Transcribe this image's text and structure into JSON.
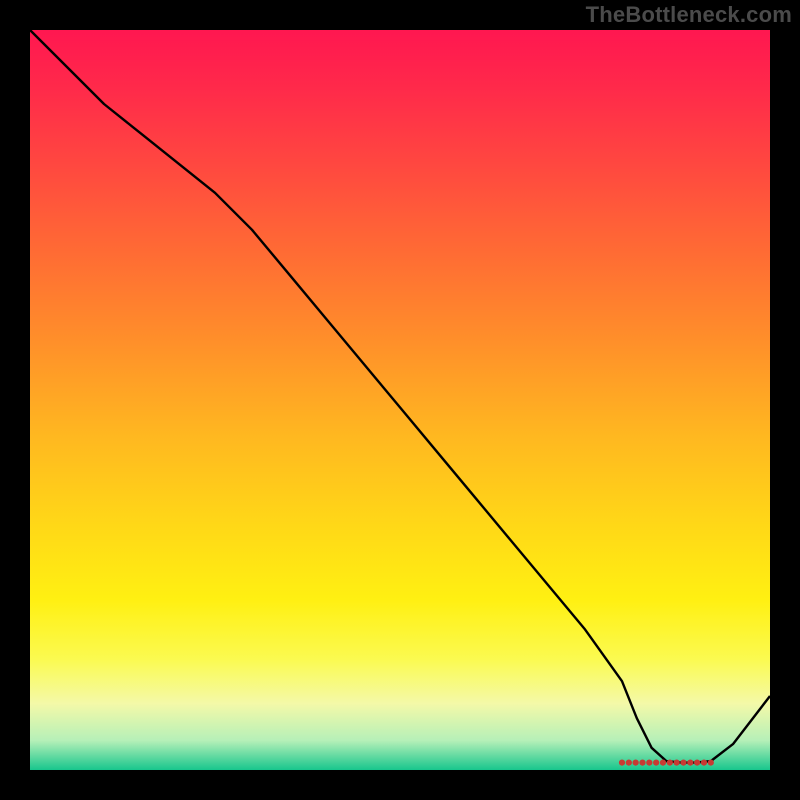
{
  "branding": {
    "watermark": "TheBottleneck.com"
  },
  "chart_data": {
    "type": "line",
    "title": "",
    "xlabel": "",
    "ylabel": "",
    "xlim": [
      0,
      100
    ],
    "ylim": [
      0,
      100
    ],
    "grid": false,
    "legend": false,
    "series": [
      {
        "name": "bottleneck-curve",
        "x": [
          0,
          5,
          10,
          15,
          20,
          25,
          30,
          35,
          40,
          45,
          50,
          55,
          60,
          65,
          70,
          75,
          80,
          82,
          84,
          86,
          88,
          90,
          92,
          95,
          100
        ],
        "y": [
          100,
          95,
          90,
          86,
          82,
          78,
          73,
          67,
          61,
          55,
          49,
          43,
          37,
          31,
          25,
          19,
          12,
          7,
          3,
          1.2,
          1.0,
          1.0,
          1.2,
          3.5,
          10
        ]
      }
    ],
    "markers": {
      "name": "optimal-region-dots",
      "x_range": [
        80,
        92
      ],
      "count": 14,
      "y": 1.0,
      "color": "#c83a33",
      "radius": 3.1
    },
    "background_gradient_stops": [
      {
        "pos": 0.0,
        "color": "#ff1750"
      },
      {
        "pos": 0.3,
        "color": "#ff6b34"
      },
      {
        "pos": 0.55,
        "color": "#ffb820"
      },
      {
        "pos": 0.77,
        "color": "#fff012"
      },
      {
        "pos": 0.91,
        "color": "#f4f9a8"
      },
      {
        "pos": 1.0,
        "color": "#18c68d"
      }
    ]
  }
}
